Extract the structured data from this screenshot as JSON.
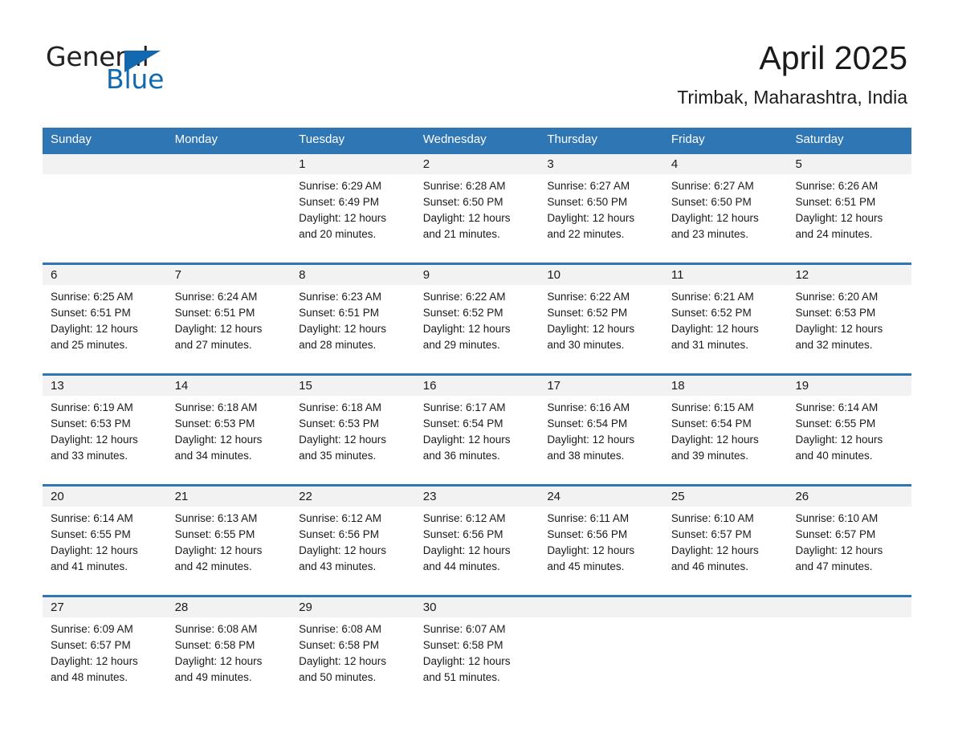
{
  "brand": {
    "name_part1": "General",
    "name_part2": "Blue",
    "accent_color": "#1269b0",
    "triangle_icon": "triangle-icon"
  },
  "header": {
    "month_title": "April 2025",
    "location": "Trimbak, Maharashtra, India"
  },
  "calendar": {
    "header_bg": "#2f76b5",
    "daynum_band_bg": "#f2f2f2",
    "weekdays": [
      "Sunday",
      "Monday",
      "Tuesday",
      "Wednesday",
      "Thursday",
      "Friday",
      "Saturday"
    ],
    "weeks": [
      [
        {
          "day": "",
          "sunrise": "",
          "sunset": "",
          "daylight_line1": "",
          "daylight_line2": "",
          "empty": true
        },
        {
          "day": "",
          "sunrise": "",
          "sunset": "",
          "daylight_line1": "",
          "daylight_line2": "",
          "empty": true
        },
        {
          "day": "1",
          "sunrise": "Sunrise: 6:29 AM",
          "sunset": "Sunset: 6:49 PM",
          "daylight_line1": "Daylight: 12 hours",
          "daylight_line2": "and 20 minutes.",
          "empty": false
        },
        {
          "day": "2",
          "sunrise": "Sunrise: 6:28 AM",
          "sunset": "Sunset: 6:50 PM",
          "daylight_line1": "Daylight: 12 hours",
          "daylight_line2": "and 21 minutes.",
          "empty": false
        },
        {
          "day": "3",
          "sunrise": "Sunrise: 6:27 AM",
          "sunset": "Sunset: 6:50 PM",
          "daylight_line1": "Daylight: 12 hours",
          "daylight_line2": "and 22 minutes.",
          "empty": false
        },
        {
          "day": "4",
          "sunrise": "Sunrise: 6:27 AM",
          "sunset": "Sunset: 6:50 PM",
          "daylight_line1": "Daylight: 12 hours",
          "daylight_line2": "and 23 minutes.",
          "empty": false
        },
        {
          "day": "5",
          "sunrise": "Sunrise: 6:26 AM",
          "sunset": "Sunset: 6:51 PM",
          "daylight_line1": "Daylight: 12 hours",
          "daylight_line2": "and 24 minutes.",
          "empty": false
        }
      ],
      [
        {
          "day": "6",
          "sunrise": "Sunrise: 6:25 AM",
          "sunset": "Sunset: 6:51 PM",
          "daylight_line1": "Daylight: 12 hours",
          "daylight_line2": "and 25 minutes.",
          "empty": false
        },
        {
          "day": "7",
          "sunrise": "Sunrise: 6:24 AM",
          "sunset": "Sunset: 6:51 PM",
          "daylight_line1": "Daylight: 12 hours",
          "daylight_line2": "and 27 minutes.",
          "empty": false
        },
        {
          "day": "8",
          "sunrise": "Sunrise: 6:23 AM",
          "sunset": "Sunset: 6:51 PM",
          "daylight_line1": "Daylight: 12 hours",
          "daylight_line2": "and 28 minutes.",
          "empty": false
        },
        {
          "day": "9",
          "sunrise": "Sunrise: 6:22 AM",
          "sunset": "Sunset: 6:52 PM",
          "daylight_line1": "Daylight: 12 hours",
          "daylight_line2": "and 29 minutes.",
          "empty": false
        },
        {
          "day": "10",
          "sunrise": "Sunrise: 6:22 AM",
          "sunset": "Sunset: 6:52 PM",
          "daylight_line1": "Daylight: 12 hours",
          "daylight_line2": "and 30 minutes.",
          "empty": false
        },
        {
          "day": "11",
          "sunrise": "Sunrise: 6:21 AM",
          "sunset": "Sunset: 6:52 PM",
          "daylight_line1": "Daylight: 12 hours",
          "daylight_line2": "and 31 minutes.",
          "empty": false
        },
        {
          "day": "12",
          "sunrise": "Sunrise: 6:20 AM",
          "sunset": "Sunset: 6:53 PM",
          "daylight_line1": "Daylight: 12 hours",
          "daylight_line2": "and 32 minutes.",
          "empty": false
        }
      ],
      [
        {
          "day": "13",
          "sunrise": "Sunrise: 6:19 AM",
          "sunset": "Sunset: 6:53 PM",
          "daylight_line1": "Daylight: 12 hours",
          "daylight_line2": "and 33 minutes.",
          "empty": false
        },
        {
          "day": "14",
          "sunrise": "Sunrise: 6:18 AM",
          "sunset": "Sunset: 6:53 PM",
          "daylight_line1": "Daylight: 12 hours",
          "daylight_line2": "and 34 minutes.",
          "empty": false
        },
        {
          "day": "15",
          "sunrise": "Sunrise: 6:18 AM",
          "sunset": "Sunset: 6:53 PM",
          "daylight_line1": "Daylight: 12 hours",
          "daylight_line2": "and 35 minutes.",
          "empty": false
        },
        {
          "day": "16",
          "sunrise": "Sunrise: 6:17 AM",
          "sunset": "Sunset: 6:54 PM",
          "daylight_line1": "Daylight: 12 hours",
          "daylight_line2": "and 36 minutes.",
          "empty": false
        },
        {
          "day": "17",
          "sunrise": "Sunrise: 6:16 AM",
          "sunset": "Sunset: 6:54 PM",
          "daylight_line1": "Daylight: 12 hours",
          "daylight_line2": "and 38 minutes.",
          "empty": false
        },
        {
          "day": "18",
          "sunrise": "Sunrise: 6:15 AM",
          "sunset": "Sunset: 6:54 PM",
          "daylight_line1": "Daylight: 12 hours",
          "daylight_line2": "and 39 minutes.",
          "empty": false
        },
        {
          "day": "19",
          "sunrise": "Sunrise: 6:14 AM",
          "sunset": "Sunset: 6:55 PM",
          "daylight_line1": "Daylight: 12 hours",
          "daylight_line2": "and 40 minutes.",
          "empty": false
        }
      ],
      [
        {
          "day": "20",
          "sunrise": "Sunrise: 6:14 AM",
          "sunset": "Sunset: 6:55 PM",
          "daylight_line1": "Daylight: 12 hours",
          "daylight_line2": "and 41 minutes.",
          "empty": false
        },
        {
          "day": "21",
          "sunrise": "Sunrise: 6:13 AM",
          "sunset": "Sunset: 6:55 PM",
          "daylight_line1": "Daylight: 12 hours",
          "daylight_line2": "and 42 minutes.",
          "empty": false
        },
        {
          "day": "22",
          "sunrise": "Sunrise: 6:12 AM",
          "sunset": "Sunset: 6:56 PM",
          "daylight_line1": "Daylight: 12 hours",
          "daylight_line2": "and 43 minutes.",
          "empty": false
        },
        {
          "day": "23",
          "sunrise": "Sunrise: 6:12 AM",
          "sunset": "Sunset: 6:56 PM",
          "daylight_line1": "Daylight: 12 hours",
          "daylight_line2": "and 44 minutes.",
          "empty": false
        },
        {
          "day": "24",
          "sunrise": "Sunrise: 6:11 AM",
          "sunset": "Sunset: 6:56 PM",
          "daylight_line1": "Daylight: 12 hours",
          "daylight_line2": "and 45 minutes.",
          "empty": false
        },
        {
          "day": "25",
          "sunrise": "Sunrise: 6:10 AM",
          "sunset": "Sunset: 6:57 PM",
          "daylight_line1": "Daylight: 12 hours",
          "daylight_line2": "and 46 minutes.",
          "empty": false
        },
        {
          "day": "26",
          "sunrise": "Sunrise: 6:10 AM",
          "sunset": "Sunset: 6:57 PM",
          "daylight_line1": "Daylight: 12 hours",
          "daylight_line2": "and 47 minutes.",
          "empty": false
        }
      ],
      [
        {
          "day": "27",
          "sunrise": "Sunrise: 6:09 AM",
          "sunset": "Sunset: 6:57 PM",
          "daylight_line1": "Daylight: 12 hours",
          "daylight_line2": "and 48 minutes.",
          "empty": false
        },
        {
          "day": "28",
          "sunrise": "Sunrise: 6:08 AM",
          "sunset": "Sunset: 6:58 PM",
          "daylight_line1": "Daylight: 12 hours",
          "daylight_line2": "and 49 minutes.",
          "empty": false
        },
        {
          "day": "29",
          "sunrise": "Sunrise: 6:08 AM",
          "sunset": "Sunset: 6:58 PM",
          "daylight_line1": "Daylight: 12 hours",
          "daylight_line2": "and 50 minutes.",
          "empty": false
        },
        {
          "day": "30",
          "sunrise": "Sunrise: 6:07 AM",
          "sunset": "Sunset: 6:58 PM",
          "daylight_line1": "Daylight: 12 hours",
          "daylight_line2": "and 51 minutes.",
          "empty": false
        },
        {
          "day": "",
          "sunrise": "",
          "sunset": "",
          "daylight_line1": "",
          "daylight_line2": "",
          "empty": true
        },
        {
          "day": "",
          "sunrise": "",
          "sunset": "",
          "daylight_line1": "",
          "daylight_line2": "",
          "empty": true
        },
        {
          "day": "",
          "sunrise": "",
          "sunset": "",
          "daylight_line1": "",
          "daylight_line2": "",
          "empty": true
        }
      ]
    ]
  }
}
